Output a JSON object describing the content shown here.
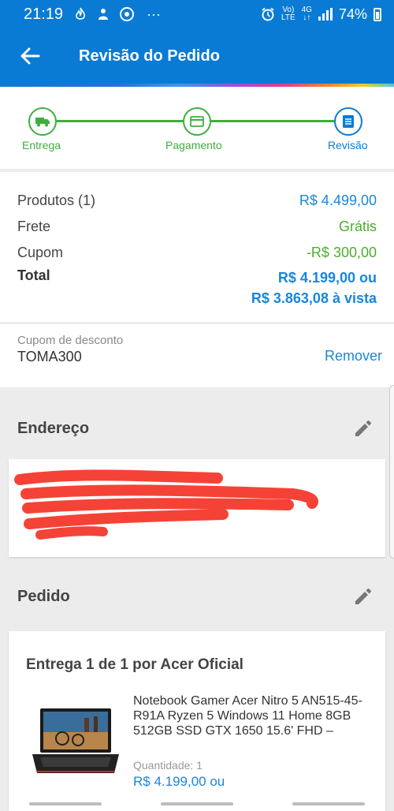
{
  "status_bar": {
    "time": "21:19",
    "dots": "···",
    "volte_top": "Vo)",
    "volte_bottom": "LTE",
    "net_top": "4G",
    "net_bottom": "↓↑",
    "battery": "74%"
  },
  "app_bar": {
    "title": "Revisão do Pedido"
  },
  "stepper": {
    "steps": [
      {
        "label": "Entrega"
      },
      {
        "label": "Pagamento"
      },
      {
        "label": "Revisão"
      }
    ],
    "colors": {
      "done": "#3fae3f",
      "current": "#0a7bd4"
    }
  },
  "summary": {
    "products_label": "Produtos (1)",
    "products_value": "R$ 4.499,00",
    "shipping_label": "Frete",
    "shipping_value": "Grátis",
    "coupon_label": "Cupom",
    "coupon_value": "-R$ 300,00",
    "total_label": "Total",
    "total_value": "R$ 4.199,00 ou",
    "total_cash": "R$ 3.863,08 à vista"
  },
  "coupon_box": {
    "label": "Cupom de desconto",
    "code": "TOMA300",
    "remove": "Remover"
  },
  "address": {
    "title": "Endereço"
  },
  "order": {
    "title": "Pedido",
    "delivery_title": "Entrega 1 de 1 por Acer Oficial",
    "product_name": "Notebook Gamer Acer Nitro 5 AN515-45-R91A Ryzen 5 Windows 11 Home 8GB 512GB SSD GTX 1650 15.6' FHD –",
    "quantity": "Quantidade:  1",
    "price": "R$ 4.199,00 ou"
  },
  "theme": {
    "primary": "#0a7bd4",
    "green": "#3fae3f",
    "link": "#1a86d8"
  }
}
